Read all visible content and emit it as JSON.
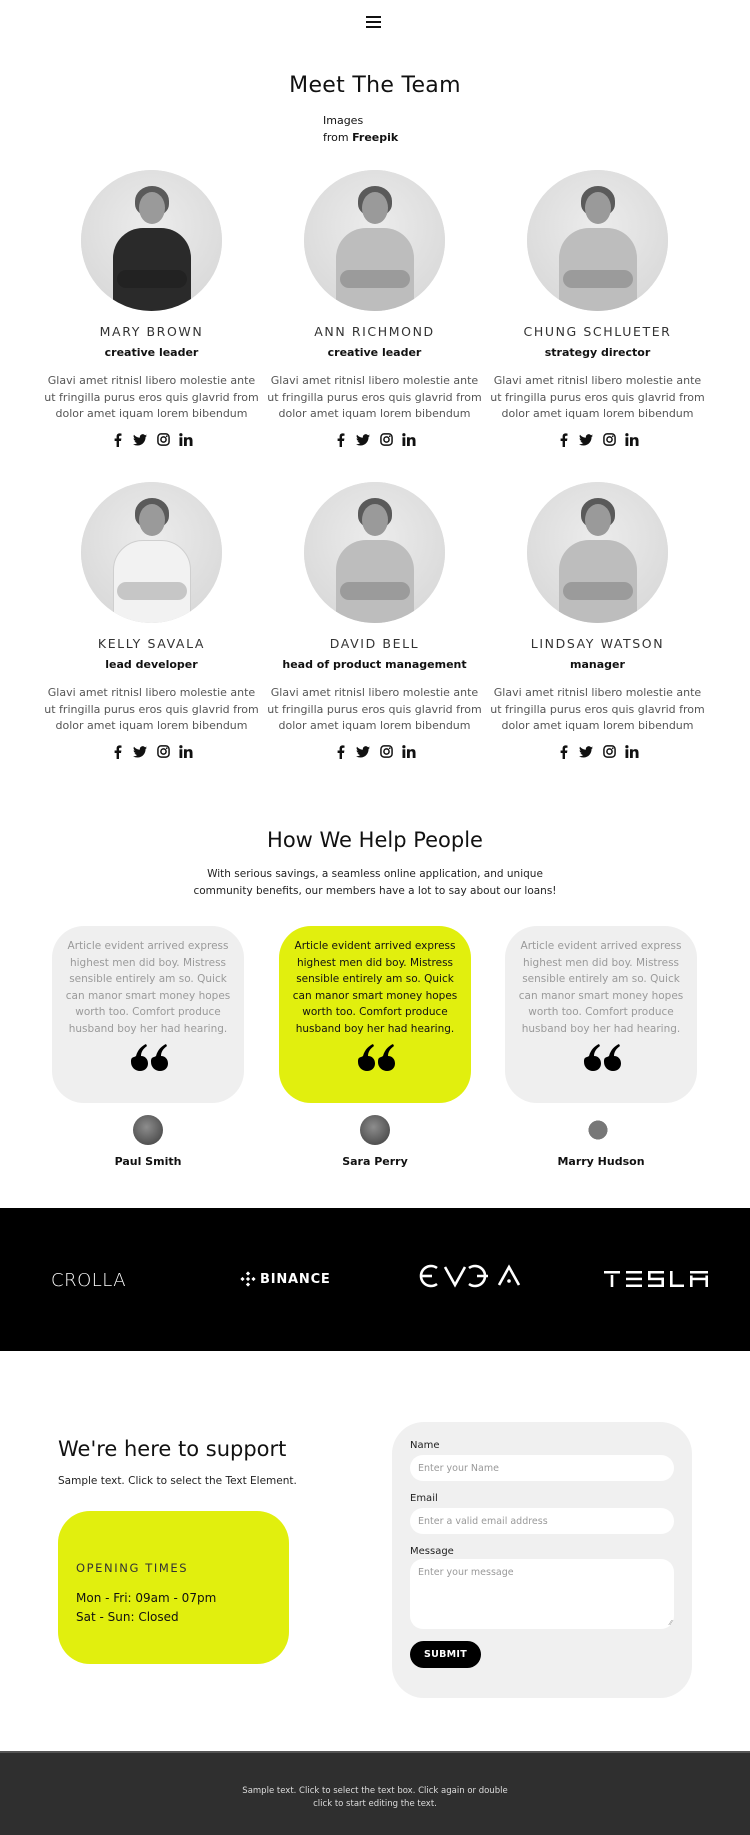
{
  "nav": {
    "menu_icon": "hamburger-menu-icon"
  },
  "team": {
    "title": "Meet The Team",
    "credit_prefix": "Images",
    "credit_from": "from",
    "credit_source": "Freepik",
    "members": [
      {
        "name": "MARY BROWN",
        "role": "creative leader",
        "desc": "Glavi amet ritnisl libero molestie ante ut fringilla purus eros quis glavrid from dolor amet iquam lorem bibendum",
        "photo": "woman-dark-blazer"
      },
      {
        "name": "ANN RICHMOND",
        "role": "creative leader",
        "desc": "Glavi amet ritnisl libero molestie ante ut fringilla purus eros quis glavrid from dolor amet iquam lorem bibendum",
        "photo": "woman-light-sweater"
      },
      {
        "name": "CHUNG SCHLUETER",
        "role": "strategy director",
        "desc": "Glavi amet ritnisl libero molestie ante ut fringilla purus eros quis glavrid from dolor amet iquam lorem bibendum",
        "photo": "man-tshirt"
      },
      {
        "name": "KELLY SAVALA",
        "role": "lead developer",
        "desc": "Glavi amet ritnisl libero molestie ante ut fringilla purus eros quis glavrid from dolor amet iquam lorem bibendum",
        "photo": "woman-white-shirt"
      },
      {
        "name": "DAVID BELL",
        "role": "head of product management",
        "desc": "Glavi amet ritnisl libero molestie ante ut fringilla purus eros quis glavrid from dolor amet iquam lorem bibendum",
        "photo": "man-glasses-blazer"
      },
      {
        "name": "LINDSAY WATSON",
        "role": "manager",
        "desc": "Glavi amet ritnisl libero molestie ante ut fringilla purus eros quis glavrid from dolor amet iquam lorem bibendum",
        "photo": "woman-long-hair"
      }
    ],
    "social_icons": [
      "facebook-icon",
      "twitter-icon",
      "instagram-icon",
      "linkedin-icon"
    ]
  },
  "help": {
    "title": "How We Help People",
    "subtitle_line1": "With serious savings, a seamless online application, and unique",
    "subtitle_line2": "community benefits, our members have a lot to say about our loans!",
    "testimonials": [
      {
        "text": "Article evident arrived express highest men did boy. Mistress sensible entirely am so. Quick can manor smart money hopes worth too. Comfort produce husband boy her had hearing.",
        "author": "Paul Smith",
        "highlighted": false
      },
      {
        "text": "Article evident arrived express highest men did boy. Mistress sensible entirely am so. Quick can manor smart money hopes worth too. Comfort produce husband boy her had hearing.",
        "author": "Sara Perry",
        "highlighted": true
      },
      {
        "text": "Article evident arrived express highest men did boy. Mistress sensible entirely am so. Quick can manor smart money hopes worth too. Comfort produce husband boy her had hearing.",
        "author": "Marry Hudson",
        "highlighted": false
      }
    ],
    "accent_color": "#e1ef0e"
  },
  "brands": {
    "logos": [
      "CROLLA",
      "BINANCE",
      "EVGA",
      "TESLA"
    ]
  },
  "support": {
    "title": "We're here to support",
    "subtitle": "Sample text. Click to select the Text Element.",
    "hours_title": "OPENING TIMES",
    "hours_weekday": "Mon - Fri: 09am - 07pm",
    "hours_weekend": "Sat - Sun: Closed"
  },
  "form": {
    "name_label": "Name",
    "name_placeholder": "Enter your Name",
    "email_label": "Email",
    "email_placeholder": "Enter a valid email address",
    "message_label": "Message",
    "message_placeholder": "Enter your message",
    "submit_label": "SUBMIT"
  },
  "footer": {
    "line1": "Sample text. Click to select the text box. Click again or double",
    "line2": "click to start editing the text."
  }
}
